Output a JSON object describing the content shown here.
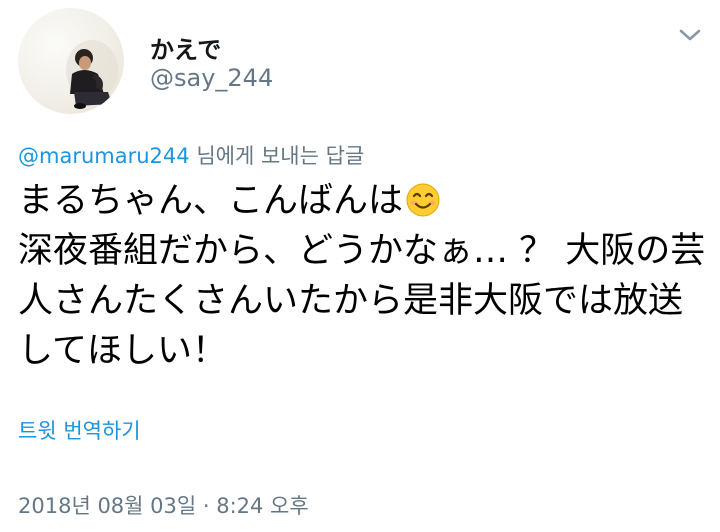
{
  "user": {
    "display_name": "かえで",
    "handle": "@say_244",
    "avatar_icon": "profile-photo"
  },
  "menu": {
    "icon": "chevron-down-icon"
  },
  "reply": {
    "mention": "@marumaru244",
    "suffix": "님에게 보내는 답글"
  },
  "tweet": {
    "line1": "まるちゃん、こんばんは",
    "emoji": "smiling-face-icon",
    "rest": "深夜番組だから、どうかなぁ… ？ 大阪の芸人さんたくさんいたから是非大阪では放送してほしい！"
  },
  "actions": {
    "translate_label": "트윗 번역하기"
  },
  "meta": {
    "timestamp": "2018년 08월 03일 · 8:24 오후"
  },
  "colors": {
    "link": "#1b95e0",
    "secondary_text": "#657786",
    "primary_text": "#14171a"
  }
}
